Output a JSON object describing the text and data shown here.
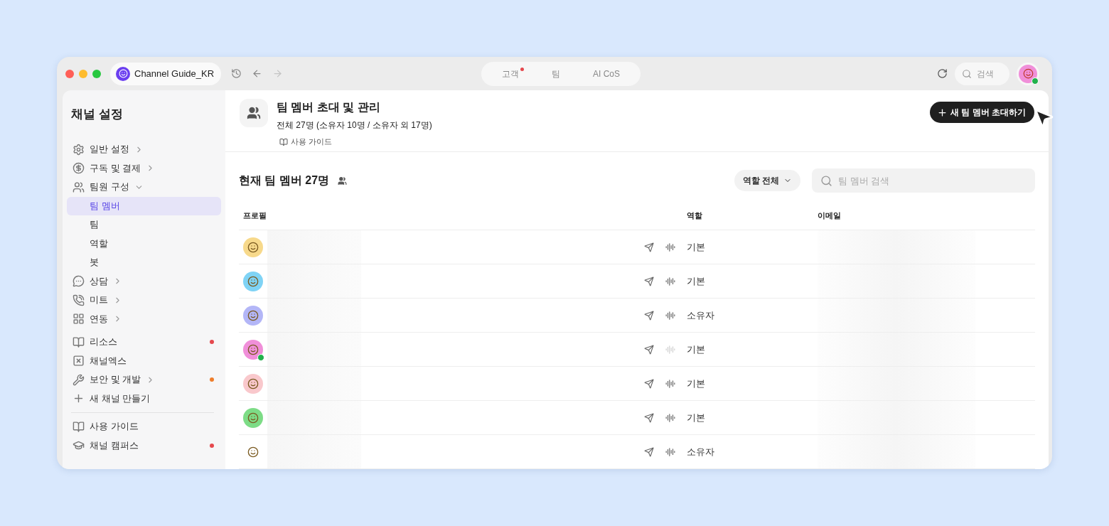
{
  "titlebar": {
    "workspace": "Channel Guide_KR",
    "tabs": [
      {
        "label": "고객",
        "notification": true
      },
      {
        "label": "팀",
        "notification": false
      },
      {
        "label": "AI CoS",
        "notification": false
      }
    ],
    "search": {
      "placeholder": "검색"
    },
    "user_online": true
  },
  "sidebar": {
    "title": "채널 설정",
    "items": [
      {
        "label": "일반 설정",
        "kind": "group",
        "expanded": false
      },
      {
        "label": "구독 및 결제",
        "kind": "group",
        "expanded": false
      },
      {
        "label": "팀원 구성",
        "kind": "group",
        "expanded": true,
        "children": [
          {
            "label": "팀 멤버",
            "selected": true
          },
          {
            "label": "팀",
            "selected": false
          },
          {
            "label": "역할",
            "selected": false
          },
          {
            "label": "봇",
            "selected": false
          }
        ]
      },
      {
        "label": "상담",
        "kind": "group",
        "expanded": false
      },
      {
        "label": "미트",
        "kind": "group",
        "expanded": false
      },
      {
        "label": "연동",
        "kind": "group",
        "expanded": false
      },
      {
        "label": "리소스",
        "kind": "link",
        "color": "#e5484d"
      },
      {
        "label": "채널엑스",
        "kind": "link"
      },
      {
        "label": "보안 및 개발",
        "kind": "group",
        "expanded": false,
        "color": "#ee7d2b"
      },
      {
        "label": "새 채널 만들기",
        "kind": "link"
      }
    ],
    "footer": [
      {
        "label": "사용 가이드"
      },
      {
        "label": "채널 캠퍼스",
        "color": "#e5484d"
      }
    ]
  },
  "header": {
    "title": "팀 멤버 초대 및 관리",
    "subtitle": "전체 27명 (소유자 10명 / 소유자 외 17명)",
    "guide_link": "사용 가이드",
    "invite_button": "새 팀 멤버 초대하기"
  },
  "section": {
    "title": "현재 팀 멤버 27명",
    "role_filter": "역할 전체",
    "search": {
      "placeholder": "팀 멤버 검색"
    }
  },
  "table": {
    "columns": [
      "프로필",
      "역할",
      "이메일"
    ],
    "rows": [
      {
        "color": "#f7d98b",
        "online": false,
        "voice_enabled": true,
        "role": "기본"
      },
      {
        "color": "#7fd3f5",
        "online": false,
        "voice_enabled": true,
        "role": "기본"
      },
      {
        "color": "#b3b6f7",
        "online": false,
        "voice_enabled": true,
        "role": "소유자"
      },
      {
        "color": "#f08fd9",
        "online": true,
        "voice_enabled": false,
        "role": "기본"
      },
      {
        "color": "#f9c8cc",
        "online": false,
        "voice_enabled": true,
        "role": "기본"
      },
      {
        "color": "#7ddc86",
        "online": false,
        "voice_enabled": true,
        "role": "기본"
      },
      {
        "color": "#ffffff",
        "online": false,
        "voice_enabled": true,
        "role": "소유자"
      }
    ]
  }
}
